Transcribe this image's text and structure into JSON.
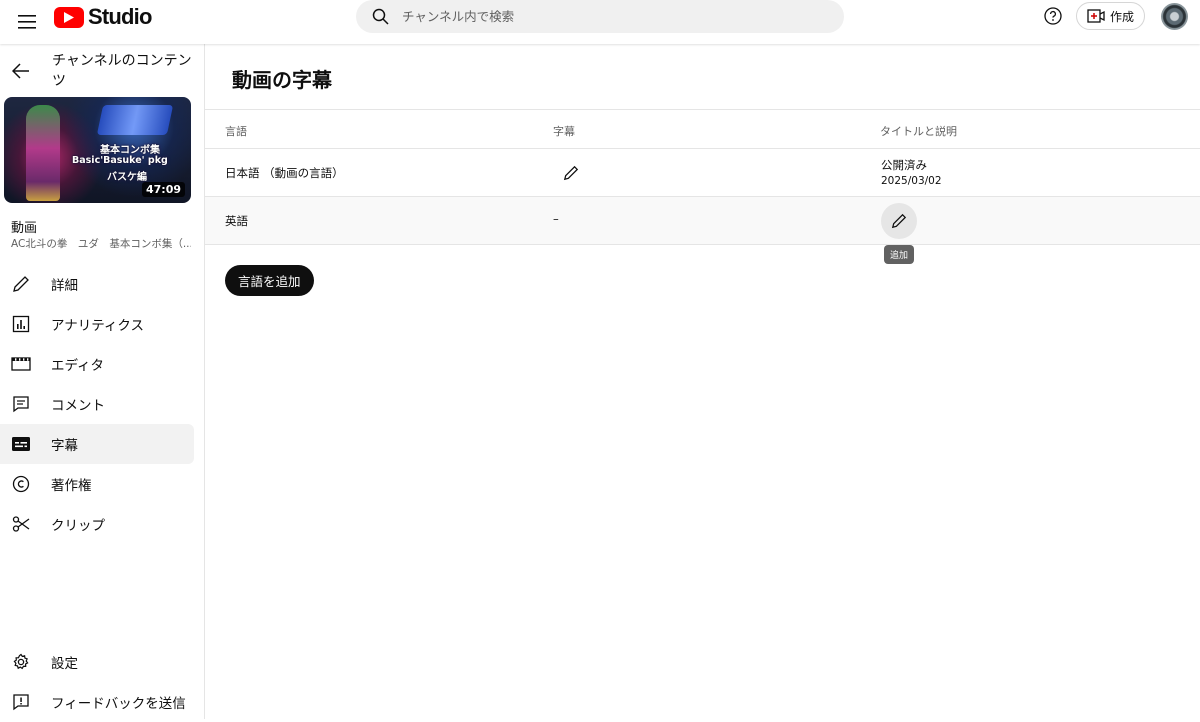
{
  "header": {
    "logo_text": "Studio",
    "search_placeholder": "チャンネル内で検索",
    "create_label": "作成"
  },
  "sidebar": {
    "back_label": "チャンネルのコンテンツ",
    "thumbnail": {
      "line1": "基本コンボ集",
      "line2": "Basic'Basuke' pkg",
      "line3": "バスケ編",
      "duration": "47:09"
    },
    "video_label": "動画",
    "video_title": "AC北斗の拳　ユダ　基本コンボ集（...",
    "items": [
      {
        "label": "詳細",
        "icon": "pencil-icon"
      },
      {
        "label": "アナリティクス",
        "icon": "analytics-icon"
      },
      {
        "label": "エディタ",
        "icon": "film-icon"
      },
      {
        "label": "コメント",
        "icon": "comment-icon"
      },
      {
        "label": "字幕",
        "icon": "subtitles-icon"
      },
      {
        "label": "著作権",
        "icon": "copyright-icon"
      },
      {
        "label": "クリップ",
        "icon": "scissors-icon"
      }
    ],
    "bottom_items": [
      {
        "label": "設定",
        "icon": "gear-icon"
      },
      {
        "label": "フィードバックを送信",
        "icon": "feedback-icon"
      }
    ]
  },
  "main": {
    "title": "動画の字幕",
    "columns": [
      "言語",
      "字幕",
      "タイトルと説明"
    ],
    "rows": [
      {
        "language": "日本語 （動画の言語）",
        "status": "公開済み",
        "date": "2025/03/02"
      },
      {
        "language": "英語",
        "subtitle": "–"
      }
    ],
    "tooltip": "追加",
    "add_language_button": "言語を追加"
  }
}
